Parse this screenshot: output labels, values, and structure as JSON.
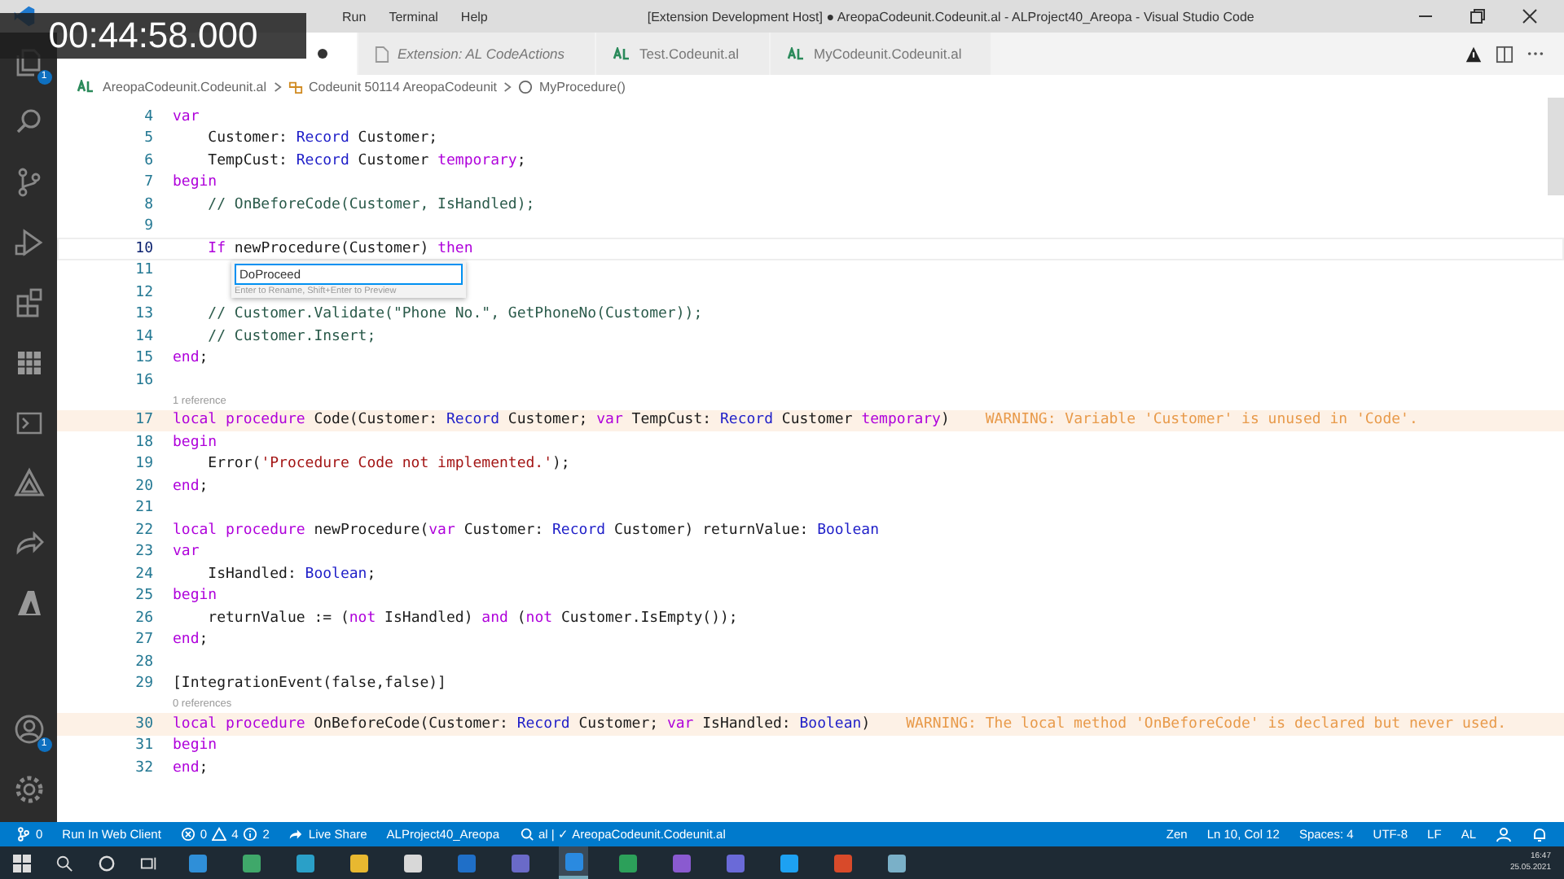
{
  "video_overlay": {
    "timestamp": "00:44:58.000"
  },
  "window": {
    "menu": [
      "Run",
      "Terminal",
      "Help"
    ],
    "title": "[Extension Development Host] ● AreopaCodeunit.Codeunit.al - ALProject40_Areopa - Visual Studio Code"
  },
  "activity_bar": {
    "explorer_badge": "1",
    "accounts_badge": "1"
  },
  "tabs": [
    {
      "selected": true,
      "modified": true
    },
    {
      "kind": "preview",
      "label": "Extension: AL CodeActions",
      "selected": false,
      "modified": false
    },
    {
      "kind": "al",
      "label": "Test.Codeunit.al",
      "selected": false,
      "modified": false
    },
    {
      "kind": "al",
      "label": "MyCodeunit.Codeunit.al",
      "selected": false,
      "modified": false
    }
  ],
  "breadcrumb": [
    "AreopaCodeunit.Codeunit.al",
    "Codeunit 50114 AreopaCodeunit",
    "MyProcedure()"
  ],
  "editor": {
    "rename": {
      "value": "DoProceed",
      "hint": "Enter to Rename, Shift+Enter to Preview"
    },
    "lines": [
      {
        "number": "4",
        "tokens": [
          {
            "kind": "keyword",
            "text": "var"
          }
        ]
      },
      {
        "number": "5",
        "tokens": [
          {
            "kind": "plain",
            "text": "    Customer: "
          },
          {
            "kind": "type",
            "text": "Record"
          },
          {
            "kind": "plain",
            "text": " Customer;"
          }
        ]
      },
      {
        "number": "6",
        "tokens": [
          {
            "kind": "plain",
            "text": "    TempCust: "
          },
          {
            "kind": "type",
            "text": "Record"
          },
          {
            "kind": "plain",
            "text": " Customer "
          },
          {
            "kind": "keyword",
            "text": "temporary"
          },
          {
            "kind": "plain",
            "text": ";"
          }
        ]
      },
      {
        "number": "7",
        "tokens": [
          {
            "kind": "keyword",
            "text": "begin"
          }
        ]
      },
      {
        "number": "8",
        "tokens": [
          {
            "kind": "comment",
            "text": "    // OnBeforeCode(Customer, IsHandled);"
          }
        ]
      },
      {
        "number": "9"
      },
      {
        "number": "10",
        "current": true,
        "tokens": [
          {
            "kind": "keyword",
            "text": "    If"
          },
          {
            "kind": "plain",
            "text": " newProcedure(Customer) "
          },
          {
            "kind": "keyword",
            "text": "then"
          }
        ]
      },
      {
        "number": "11",
        "rename": true
      },
      {
        "number": "12"
      },
      {
        "number": "13",
        "tokens": [
          {
            "kind": "comment",
            "text": "    // Customer.Validate(\"Phone No.\", GetPhoneNo(Customer));"
          }
        ]
      },
      {
        "number": "14",
        "tokens": [
          {
            "kind": "comment",
            "text": "    // Customer.Insert;"
          }
        ]
      },
      {
        "number": "15",
        "tokens": [
          {
            "kind": "keyword",
            "text": "end"
          },
          {
            "kind": "plain",
            "text": ";"
          }
        ]
      },
      {
        "number": "16"
      },
      {
        "number": "17",
        "codelens": "1 reference",
        "tokens": [
          {
            "kind": "keyword",
            "text": "local procedure"
          },
          {
            "kind": "plain",
            "text": " Code(Customer: "
          },
          {
            "kind": "type",
            "text": "Record"
          },
          {
            "kind": "plain",
            "text": " Customer; "
          },
          {
            "kind": "keyword",
            "text": "var"
          },
          {
            "kind": "plain",
            "text": " TempCust: "
          },
          {
            "kind": "type",
            "text": "Record"
          },
          {
            "kind": "plain",
            "text": " Customer "
          },
          {
            "kind": "keyword",
            "text": "temporary"
          },
          {
            "kind": "plain",
            "text": ")"
          }
        ],
        "warning": "WARNING: Variable 'Customer' is unused in 'Code'."
      },
      {
        "number": "18",
        "tokens": [
          {
            "kind": "keyword",
            "text": "begin"
          }
        ]
      },
      {
        "number": "19",
        "tokens": [
          {
            "kind": "plain",
            "text": "    Error("
          },
          {
            "kind": "string",
            "text": "'Procedure Code not implemented.'"
          },
          {
            "kind": "plain",
            "text": ");"
          }
        ]
      },
      {
        "number": "20",
        "tokens": [
          {
            "kind": "keyword",
            "text": "end"
          },
          {
            "kind": "plain",
            "text": ";"
          }
        ]
      },
      {
        "number": "21"
      },
      {
        "number": "22",
        "tokens": [
          {
            "kind": "keyword",
            "text": "local procedure"
          },
          {
            "kind": "plain",
            "text": " newProcedure("
          },
          {
            "kind": "keyword",
            "text": "var"
          },
          {
            "kind": "plain",
            "text": " Customer: "
          },
          {
            "kind": "type",
            "text": "Record"
          },
          {
            "kind": "plain",
            "text": " Customer) returnValue: "
          },
          {
            "kind": "type",
            "text": "Boolean"
          }
        ]
      },
      {
        "number": "23",
        "tokens": [
          {
            "kind": "keyword",
            "text": "var"
          }
        ]
      },
      {
        "number": "24",
        "tokens": [
          {
            "kind": "plain",
            "text": "    IsHandled: "
          },
          {
            "kind": "type",
            "text": "Boolean"
          },
          {
            "kind": "plain",
            "text": ";"
          }
        ]
      },
      {
        "number": "25",
        "tokens": [
          {
            "kind": "keyword",
            "text": "begin"
          }
        ]
      },
      {
        "number": "26",
        "tokens": [
          {
            "kind": "plain",
            "text": "    returnValue := ("
          },
          {
            "kind": "keyword",
            "text": "not"
          },
          {
            "kind": "plain",
            "text": " IsHandled) "
          },
          {
            "kind": "keyword",
            "text": "and"
          },
          {
            "kind": "plain",
            "text": " ("
          },
          {
            "kind": "keyword",
            "text": "not"
          },
          {
            "kind": "plain",
            "text": " Customer.IsEmpty());"
          }
        ]
      },
      {
        "number": "27",
        "tokens": [
          {
            "kind": "keyword",
            "text": "end"
          },
          {
            "kind": "plain",
            "text": ";"
          }
        ]
      },
      {
        "number": "28"
      },
      {
        "number": "29",
        "tokens": [
          {
            "kind": "plain",
            "text": "[IntegrationEvent(false,false)]"
          }
        ]
      },
      {
        "number": "30",
        "codelens": "0 references",
        "tokens": [
          {
            "kind": "keyword",
            "text": "local procedure"
          },
          {
            "kind": "plain",
            "text": " OnBeforeCode(Customer: "
          },
          {
            "kind": "type",
            "text": "Record"
          },
          {
            "kind": "plain",
            "text": " Customer; "
          },
          {
            "kind": "keyword",
            "text": "var"
          },
          {
            "kind": "plain",
            "text": " IsHandled: "
          },
          {
            "kind": "type",
            "text": "Boolean"
          },
          {
            "kind": "plain",
            "text": ")"
          }
        ],
        "warning": "WARNING: The local method 'OnBeforeCode' is declared but never used."
      },
      {
        "number": "31",
        "tokens": [
          {
            "kind": "keyword",
            "text": "begin"
          }
        ]
      },
      {
        "number": "32",
        "tokens": [
          {
            "kind": "keyword",
            "text": "end"
          },
          {
            "kind": "plain",
            "text": ";"
          }
        ]
      }
    ]
  },
  "status_bar": {
    "left": [
      {
        "kind": "remote",
        "text": "0"
      },
      {
        "kind": "text",
        "text": "Run In Web Client"
      },
      {
        "kind": "problems",
        "errors": "0",
        "warnings": "4",
        "infos": "2"
      },
      {
        "kind": "share",
        "text": "Live Share"
      },
      {
        "kind": "text",
        "text": "ALProject40_Areopa"
      },
      {
        "kind": "check",
        "text": "al | ✓ AreopaCodeunit.Codeunit.al"
      }
    ],
    "right": [
      "Zen",
      "Ln 10, Col 12",
      "Spaces: 4",
      "UTF-8",
      "LF",
      "AL"
    ]
  },
  "taskbar": {
    "apps": [
      {
        "color": "#2f8fd8",
        "selected": false
      },
      {
        "color": "#3fa86a",
        "selected": false
      },
      {
        "color": "#2aa0c8",
        "selected": false
      },
      {
        "color": "#e8b830",
        "selected": false
      },
      {
        "color": "#d8d8d8",
        "selected": false
      },
      {
        "color": "#1f6fc8",
        "selected": false
      },
      {
        "color": "#6a6ac8",
        "selected": false
      },
      {
        "color": "#2a8ae0",
        "selected": true
      },
      {
        "color": "#2ca05a",
        "selected": false
      },
      {
        "color": "#8a5ad0",
        "selected": false
      },
      {
        "color": "#6a6ad8",
        "selected": false
      },
      {
        "color": "#1da1f2",
        "selected": false
      },
      {
        "color": "#d84a2a",
        "selected": false
      },
      {
        "color": "#7ab0c8",
        "selected": false
      }
    ],
    "time": "16:47",
    "date": "25.05.2021"
  }
}
